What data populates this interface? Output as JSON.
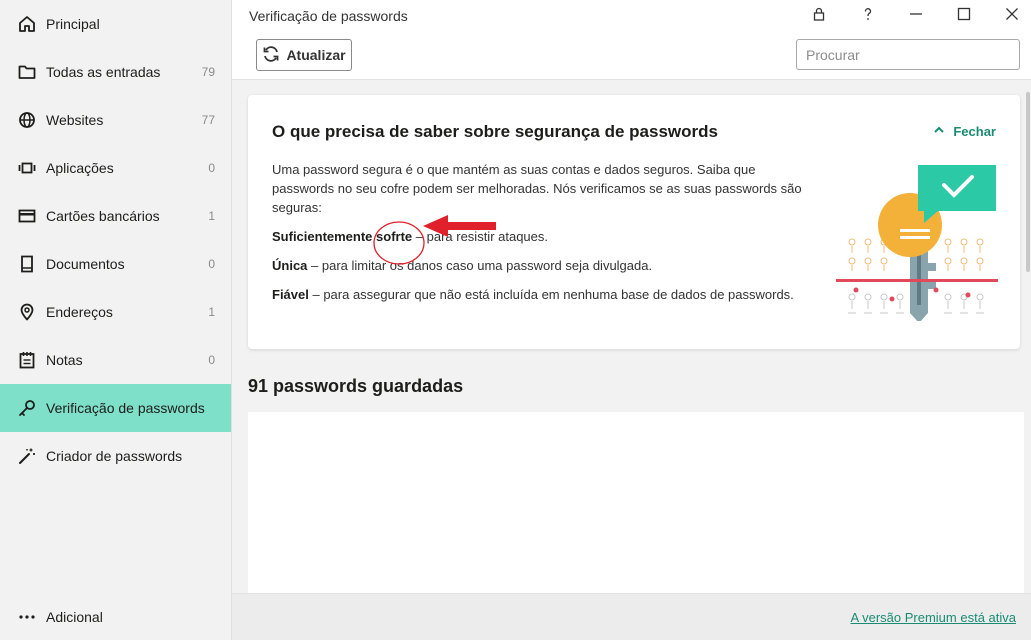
{
  "sidebar": {
    "items": [
      {
        "label": "Principal",
        "count": "",
        "icon": "home-icon"
      },
      {
        "label": "Todas as entradas",
        "count": "79",
        "icon": "folder-icon"
      },
      {
        "label": "Websites",
        "count": "77",
        "icon": "globe-icon"
      },
      {
        "label": "Aplicações",
        "count": "0",
        "icon": "app-window-icon"
      },
      {
        "label": "Cartões bancários",
        "count": "1",
        "icon": "credit-card-icon"
      },
      {
        "label": "Documentos",
        "count": "0",
        "icon": "document-icon"
      },
      {
        "label": "Endereços",
        "count": "1",
        "icon": "location-pin-icon"
      },
      {
        "label": "Notas",
        "count": "0",
        "icon": "notes-icon"
      },
      {
        "label": "Verificação de passwords",
        "count": "",
        "icon": "key-icon"
      },
      {
        "label": "Criador de passwords",
        "count": "",
        "icon": "magic-wand-icon"
      }
    ],
    "additional": {
      "label": "Adicional",
      "icon": "more-dots-icon"
    }
  },
  "header": {
    "title": "Verificação de passwords",
    "update_label": "Atualizar",
    "search_placeholder": "Procurar"
  },
  "info_card": {
    "title": "O que precisa de saber sobre segurança de passwords",
    "close_label": "Fechar",
    "intro": "Uma password segura é o que mantém as suas contas e dados seguros. Saiba que passwords no seu cofre podem ser melhoradas. Nós verificamos se as suas passwords são seguras:",
    "criteria": [
      {
        "term": "Suficientemente sofrte",
        "description": " – para resistir ataques."
      },
      {
        "term": "Única",
        "description": " – para limitar os danos caso uma password seja divulgada."
      },
      {
        "term": "Fiável",
        "description": " – para assegurar que não está incluída em nenhuma base de dados de passwords."
      }
    ]
  },
  "passwords_section": {
    "title": "91 passwords guardadas"
  },
  "footer": {
    "premium_label": "A versão Premium está ativa"
  },
  "colors": {
    "accent": "#7ee0c9",
    "link": "#1a8c74",
    "annotation": "#e0212b"
  }
}
